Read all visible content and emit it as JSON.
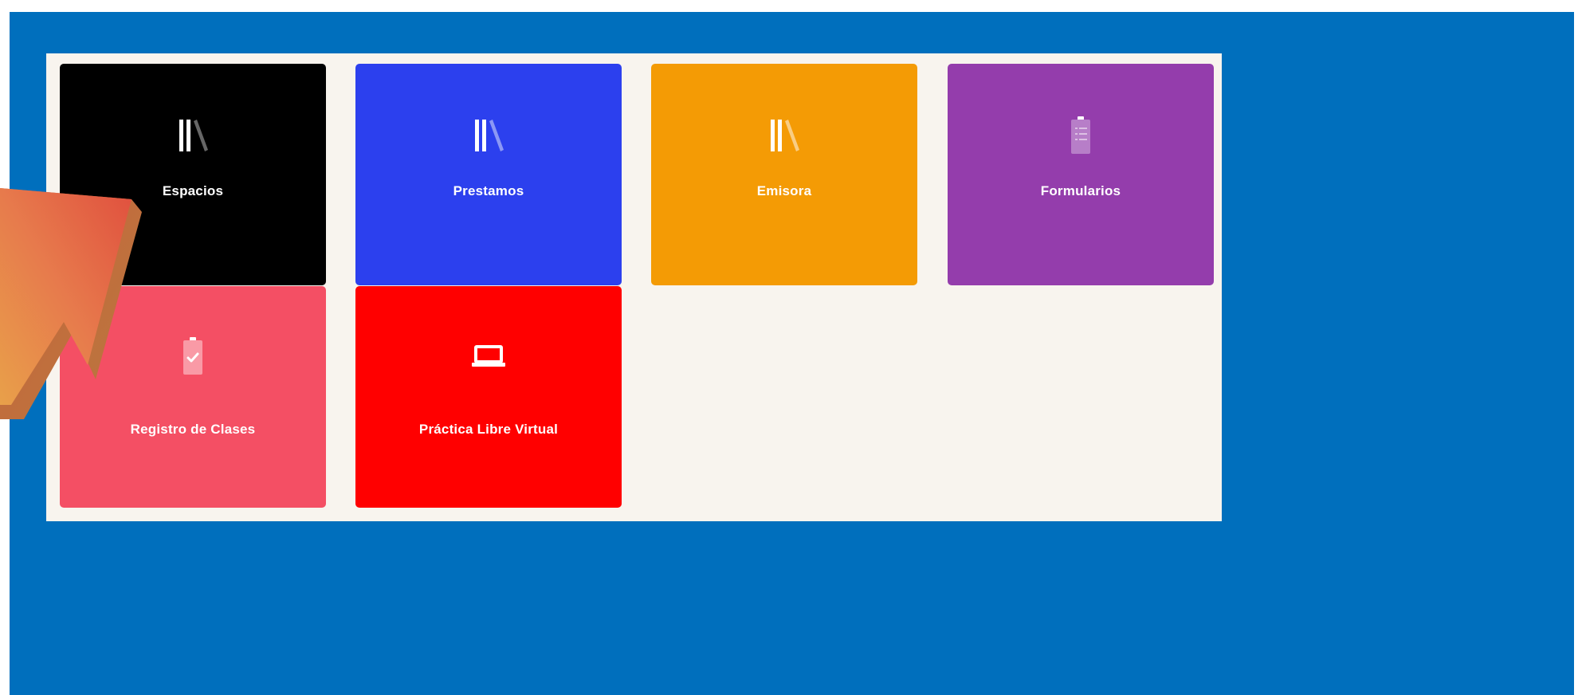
{
  "colors": {
    "frame_bg": "#006fbd",
    "panel_bg": "#f8f4ee",
    "arrow_start": "#e36a4a",
    "arrow_end": "#e89a4a"
  },
  "tiles": [
    {
      "label": "Espacios",
      "icon": "books-icon",
      "color": "#000000"
    },
    {
      "label": "Prestamos",
      "icon": "books-icon",
      "color": "#2c40ee"
    },
    {
      "label": "Emisora",
      "icon": "books-icon",
      "color": "#f49b05"
    },
    {
      "label": "Formularios",
      "icon": "clipboard-list-icon",
      "color": "#943dac"
    },
    {
      "label": "Registro de Clases",
      "icon": "clipboard-check-icon",
      "color": "#f44f64"
    },
    {
      "label": "Práctica Libre Virtual",
      "icon": "laptop-icon",
      "color": "#ff0000"
    }
  ]
}
